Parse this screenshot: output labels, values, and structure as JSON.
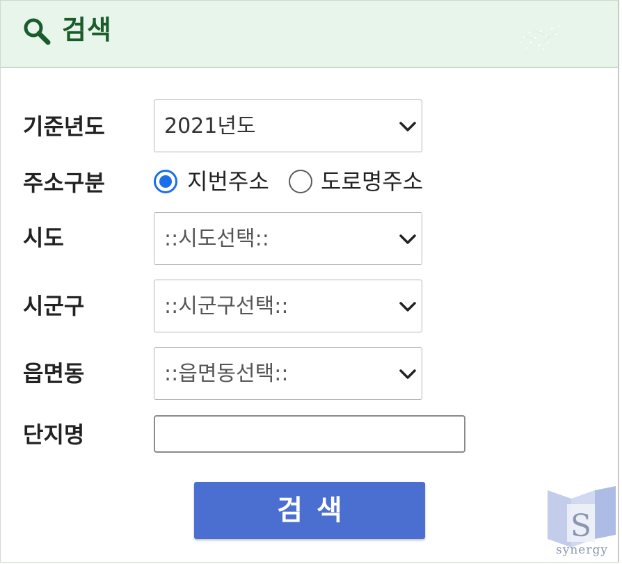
{
  "header": {
    "title": "검색",
    "icon": "search-icon",
    "accent_color": "#1a5c2a",
    "background_color": "#e8f5ea"
  },
  "form": {
    "year": {
      "label": "기준년도",
      "selected": "2021년도"
    },
    "address_type": {
      "label": "주소구분",
      "options": [
        {
          "label": "지번주소",
          "checked": true
        },
        {
          "label": "도로명주소",
          "checked": false
        }
      ]
    },
    "sido": {
      "label": "시도",
      "selected": "::시도선택::"
    },
    "sigungu": {
      "label": "시군구",
      "selected": "::시군구선택::"
    },
    "eupmyeondong": {
      "label": "읍면동",
      "selected": "::읍면동선택::"
    },
    "complex_name": {
      "label": "단지명",
      "value": "",
      "placeholder": ""
    }
  },
  "search_button": {
    "label": "검색",
    "color": "#4a6fd0"
  },
  "watermark": {
    "text": "synergy",
    "letter": "S"
  }
}
